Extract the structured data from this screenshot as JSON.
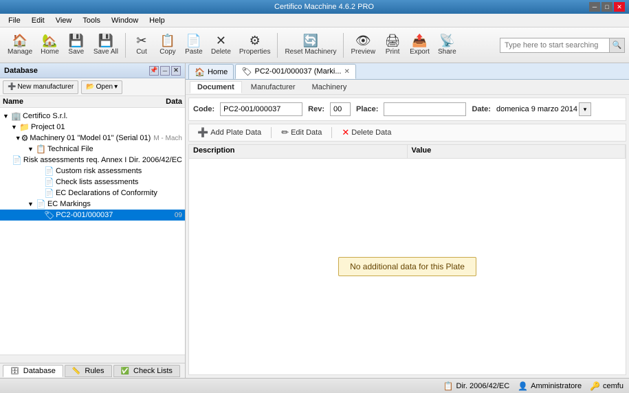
{
  "app": {
    "title": "Certifico Macchine 4.6.2 PRO",
    "title_controls": {
      "minimize": "─",
      "maximize": "□",
      "close": "✕"
    }
  },
  "menu": {
    "items": [
      "File",
      "Edit",
      "View",
      "Tools",
      "Window",
      "Help"
    ]
  },
  "toolbar": {
    "buttons": [
      {
        "id": "manage",
        "label": "Manage",
        "icon": "🏠"
      },
      {
        "id": "home",
        "label": "Home",
        "icon": "🏡"
      },
      {
        "id": "save",
        "label": "Save",
        "icon": "💾"
      },
      {
        "id": "save-all",
        "label": "Save All",
        "icon": "💾"
      },
      {
        "id": "cut",
        "label": "Cut",
        "icon": "✂"
      },
      {
        "id": "copy",
        "label": "Copy",
        "icon": "📋"
      },
      {
        "id": "paste",
        "label": "Paste",
        "icon": "📄"
      },
      {
        "id": "delete",
        "label": "Delete",
        "icon": "✕"
      },
      {
        "id": "properties",
        "label": "Properties",
        "icon": "⚙"
      },
      {
        "id": "reset-machinery",
        "label": "Reset Machinery",
        "icon": "🔄"
      },
      {
        "id": "preview",
        "label": "Preview",
        "icon": "👁"
      },
      {
        "id": "print",
        "label": "Print",
        "icon": "🖨"
      },
      {
        "id": "export",
        "label": "Export",
        "icon": "📤"
      },
      {
        "id": "share",
        "label": "Share",
        "icon": "📡"
      }
    ],
    "search_placeholder": "Type here to start searching"
  },
  "left_panel": {
    "title": "Database",
    "controls": {
      "pin": "📌",
      "minimize": "─",
      "close": "✕"
    },
    "new_manufacturer": "New manufacturer",
    "open": "Open",
    "column_name": "Name",
    "column_data": "Data",
    "tree": [
      {
        "id": "root",
        "label": "Certifico S.r.l.",
        "icon": "🏢",
        "indent": 0,
        "arrow": "▼",
        "badge": ""
      },
      {
        "id": "project",
        "label": "Project 01",
        "icon": "📁",
        "indent": 12,
        "arrow": "▼",
        "badge": ""
      },
      {
        "id": "machinery",
        "label": "Machinery 01 \"Model 01\" (Serial 01)",
        "icon": "⚙",
        "indent": 24,
        "arrow": "▼",
        "badge": "M - Mach"
      },
      {
        "id": "techfile",
        "label": "Technical File",
        "icon": "📋",
        "indent": 36,
        "arrow": "▼",
        "badge": ""
      },
      {
        "id": "risk-annex",
        "label": "Risk assessments req. Annex I Dir. 2006/42/EC",
        "icon": "📄",
        "indent": 48,
        "arrow": "",
        "badge": ""
      },
      {
        "id": "custom-risk",
        "label": "Custom risk assessments",
        "icon": "📄",
        "indent": 48,
        "arrow": "",
        "badge": ""
      },
      {
        "id": "checklists",
        "label": "Check lists assessments",
        "icon": "📄",
        "indent": 48,
        "arrow": "",
        "badge": ""
      },
      {
        "id": "ec-decl",
        "label": "EC Declarations of Conformity",
        "icon": "📄",
        "indent": 48,
        "arrow": "",
        "badge": ""
      },
      {
        "id": "ec-mark",
        "label": "EC Markings",
        "icon": "📄",
        "indent": 36,
        "arrow": "▼",
        "badge": ""
      },
      {
        "id": "plate",
        "label": "PC2-001/000037",
        "icon": "🏷",
        "indent": 48,
        "arrow": "",
        "badge": "09",
        "selected": true
      }
    ]
  },
  "right_panel": {
    "tabs": [
      {
        "id": "home",
        "label": "Home",
        "icon": "🏠",
        "active": false,
        "closable": false
      },
      {
        "id": "plate-tab",
        "label": "PC2-001/000037 (Marki...",
        "icon": "🏷",
        "active": true,
        "closable": true
      }
    ],
    "sub_tabs": [
      {
        "id": "document",
        "label": "Document",
        "active": true
      },
      {
        "id": "manufacturer",
        "label": "Manufacturer",
        "active": false
      },
      {
        "id": "machinery",
        "label": "Machinery",
        "active": false
      }
    ],
    "document": {
      "code_label": "Code:",
      "code_value": "PC2-001/000037",
      "rev_label": "Rev:",
      "rev_value": "00",
      "place_label": "Place:",
      "place_value": "",
      "date_label": "Date:",
      "date_value": "domenica 9 marzo 2014"
    },
    "plate_toolbar": {
      "add_label": "Add Plate Data",
      "edit_label": "Edit Data",
      "delete_label": "Delete Data"
    },
    "table": {
      "columns": [
        "Description",
        "Value"
      ],
      "no_data_message": "No additional data for this Plate"
    }
  },
  "bottom_tabs": [
    {
      "id": "database",
      "label": "Database",
      "icon": "🗄",
      "active": true
    },
    {
      "id": "rules",
      "label": "Rules",
      "icon": "📏",
      "active": false
    },
    {
      "id": "check-lists",
      "label": "Check Lists",
      "icon": "✅",
      "active": false
    }
  ],
  "status_bar": {
    "items": [
      {
        "id": "dir",
        "label": "Dir. 2006/42/EC",
        "icon": "📋"
      },
      {
        "id": "user",
        "label": "Amministratore",
        "icon": "👤"
      },
      {
        "id": "cemfu",
        "label": "cemfu",
        "icon": "🔑"
      }
    ]
  }
}
